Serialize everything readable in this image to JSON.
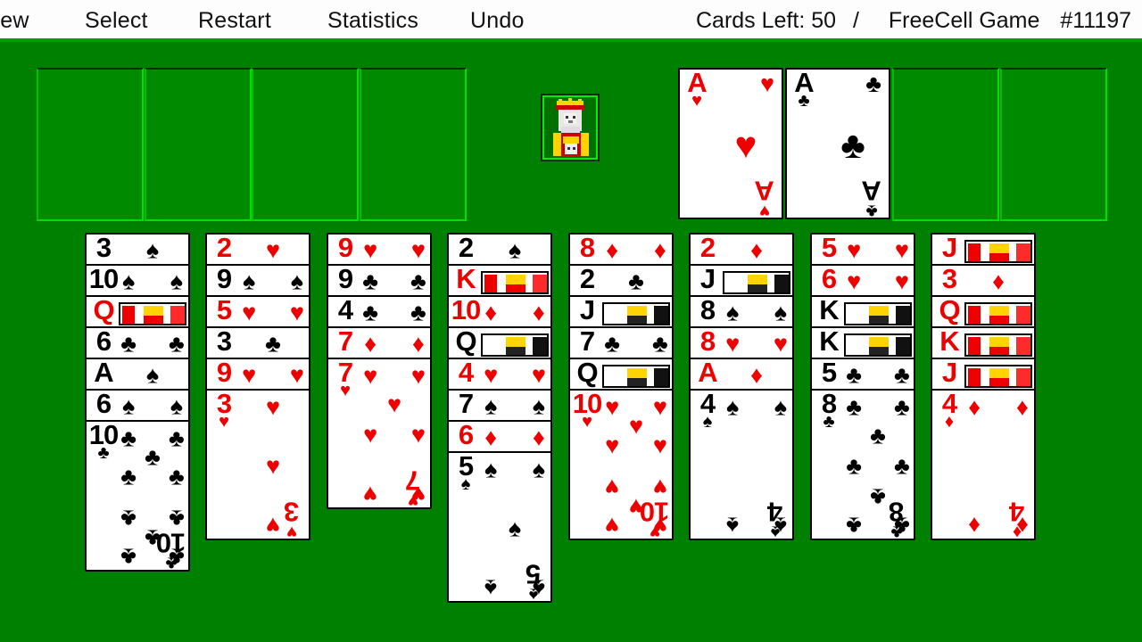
{
  "window": {
    "title": "FreeCell",
    "background_color": "#008000",
    "menubar_color": "#fdfdfd"
  },
  "menu": {
    "items": [
      {
        "id": "new",
        "label": "New"
      },
      {
        "id": "select",
        "label": "Select"
      },
      {
        "id": "restart",
        "label": "Restart"
      },
      {
        "id": "statistics",
        "label": "Statistics"
      },
      {
        "id": "undo",
        "label": "Undo"
      }
    ]
  },
  "status": {
    "cards_left_label": "Cards Left:",
    "cards_left_value": "50",
    "separator": "/",
    "game_label": "FreeCell Game",
    "game_number": "#11197"
  },
  "colors": {
    "felt": "#008000",
    "slot_border": "#00e000",
    "red_suit": "#ee0000",
    "black_suit": "#000000",
    "card_face": "#ffffff"
  },
  "logo": {
    "name": "freecell-king-logo",
    "description": "king face"
  },
  "free_cells": [
    {
      "index": 0,
      "card": null
    },
    {
      "index": 1,
      "card": null
    },
    {
      "index": 2,
      "card": null
    },
    {
      "index": 3,
      "card": null
    }
  ],
  "foundations": [
    {
      "index": 0,
      "card": {
        "rank": "A",
        "suit": "hearts",
        "pip": "♥",
        "color": "red"
      }
    },
    {
      "index": 1,
      "card": {
        "rank": "A",
        "suit": "clubs",
        "pip": "♣",
        "color": "black"
      }
    },
    {
      "index": 2,
      "card": null
    },
    {
      "index": 3,
      "card": null
    }
  ],
  "tableau": [
    {
      "column": 1,
      "cards": [
        {
          "rank": "3",
          "suit": "spades",
          "pip": "♠",
          "color": "black"
        },
        {
          "rank": "10",
          "suit": "spades",
          "pip": "♠",
          "color": "black"
        },
        {
          "rank": "Q",
          "suit": "diamonds",
          "pip": "♦",
          "color": "red"
        },
        {
          "rank": "6",
          "suit": "clubs",
          "pip": "♣",
          "color": "black"
        },
        {
          "rank": "A",
          "suit": "spades",
          "pip": "♠",
          "color": "black"
        },
        {
          "rank": "6",
          "suit": "spades",
          "pip": "♠",
          "color": "black"
        },
        {
          "rank": "10",
          "suit": "clubs",
          "pip": "♣",
          "color": "black"
        }
      ]
    },
    {
      "column": 2,
      "cards": [
        {
          "rank": "2",
          "suit": "hearts",
          "pip": "♥",
          "color": "red"
        },
        {
          "rank": "9",
          "suit": "spades",
          "pip": "♠",
          "color": "black"
        },
        {
          "rank": "5",
          "suit": "hearts",
          "pip": "♥",
          "color": "red"
        },
        {
          "rank": "3",
          "suit": "clubs",
          "pip": "♣",
          "color": "black"
        },
        {
          "rank": "9",
          "suit": "hearts",
          "pip": "♥",
          "color": "red"
        },
        {
          "rank": "3",
          "suit": "hearts",
          "pip": "♥",
          "color": "red"
        }
      ]
    },
    {
      "column": 3,
      "cards": [
        {
          "rank": "9",
          "suit": "hearts",
          "pip": "♥",
          "color": "red"
        },
        {
          "rank": "9",
          "suit": "clubs",
          "pip": "♣",
          "color": "black"
        },
        {
          "rank": "4",
          "suit": "clubs",
          "pip": "♣",
          "color": "black"
        },
        {
          "rank": "7",
          "suit": "diamonds",
          "pip": "♦",
          "color": "red"
        },
        {
          "rank": "7",
          "suit": "hearts",
          "pip": "♥",
          "color": "red"
        }
      ]
    },
    {
      "column": 4,
      "cards": [
        {
          "rank": "2",
          "suit": "spades",
          "pip": "♠",
          "color": "black"
        },
        {
          "rank": "K",
          "suit": "hearts",
          "pip": "♥",
          "color": "red"
        },
        {
          "rank": "10",
          "suit": "diamonds",
          "pip": "♦",
          "color": "red"
        },
        {
          "rank": "Q",
          "suit": "spades",
          "pip": "♠",
          "color": "black"
        },
        {
          "rank": "4",
          "suit": "hearts",
          "pip": "♥",
          "color": "red"
        },
        {
          "rank": "7",
          "suit": "spades",
          "pip": "♠",
          "color": "black"
        },
        {
          "rank": "6",
          "suit": "diamonds",
          "pip": "♦",
          "color": "red"
        },
        {
          "rank": "5",
          "suit": "spades",
          "pip": "♠",
          "color": "black"
        }
      ]
    },
    {
      "column": 5,
      "cards": [
        {
          "rank": "8",
          "suit": "diamonds",
          "pip": "♦",
          "color": "red"
        },
        {
          "rank": "2",
          "suit": "clubs",
          "pip": "♣",
          "color": "black"
        },
        {
          "rank": "J",
          "suit": "spades",
          "pip": "♠",
          "color": "black"
        },
        {
          "rank": "7",
          "suit": "clubs",
          "pip": "♣",
          "color": "black"
        },
        {
          "rank": "Q",
          "suit": "clubs",
          "pip": "♣",
          "color": "black"
        },
        {
          "rank": "10",
          "suit": "hearts",
          "pip": "♥",
          "color": "red"
        }
      ]
    },
    {
      "column": 6,
      "cards": [
        {
          "rank": "2",
          "suit": "diamonds",
          "pip": "♦",
          "color": "red"
        },
        {
          "rank": "J",
          "suit": "clubs",
          "pip": "♣",
          "color": "black"
        },
        {
          "rank": "8",
          "suit": "spades",
          "pip": "♠",
          "color": "black"
        },
        {
          "rank": "8",
          "suit": "hearts",
          "pip": "♥",
          "color": "red"
        },
        {
          "rank": "A",
          "suit": "diamonds",
          "pip": "♦",
          "color": "red"
        },
        {
          "rank": "4",
          "suit": "spades",
          "pip": "♠",
          "color": "black"
        }
      ]
    },
    {
      "column": 7,
      "cards": [
        {
          "rank": "5",
          "suit": "hearts",
          "pip": "♥",
          "color": "red"
        },
        {
          "rank": "6",
          "suit": "hearts",
          "pip": "♥",
          "color": "red"
        },
        {
          "rank": "K",
          "suit": "spades",
          "pip": "♠",
          "color": "black"
        },
        {
          "rank": "K",
          "suit": "clubs",
          "pip": "♣",
          "color": "black"
        },
        {
          "rank": "5",
          "suit": "clubs",
          "pip": "♣",
          "color": "black"
        },
        {
          "rank": "8",
          "suit": "clubs",
          "pip": "♣",
          "color": "black"
        }
      ]
    },
    {
      "column": 8,
      "cards": [
        {
          "rank": "J",
          "suit": "hearts",
          "pip": "♥",
          "color": "red"
        },
        {
          "rank": "3",
          "suit": "diamonds",
          "pip": "♦",
          "color": "red"
        },
        {
          "rank": "Q",
          "suit": "hearts",
          "pip": "♥",
          "color": "red"
        },
        {
          "rank": "K",
          "suit": "diamonds",
          "pip": "♦",
          "color": "red"
        },
        {
          "rank": "J",
          "suit": "diamonds",
          "pip": "♦",
          "color": "red"
        },
        {
          "rank": "4",
          "suit": "diamonds",
          "pip": "♦",
          "color": "red"
        }
      ]
    }
  ]
}
